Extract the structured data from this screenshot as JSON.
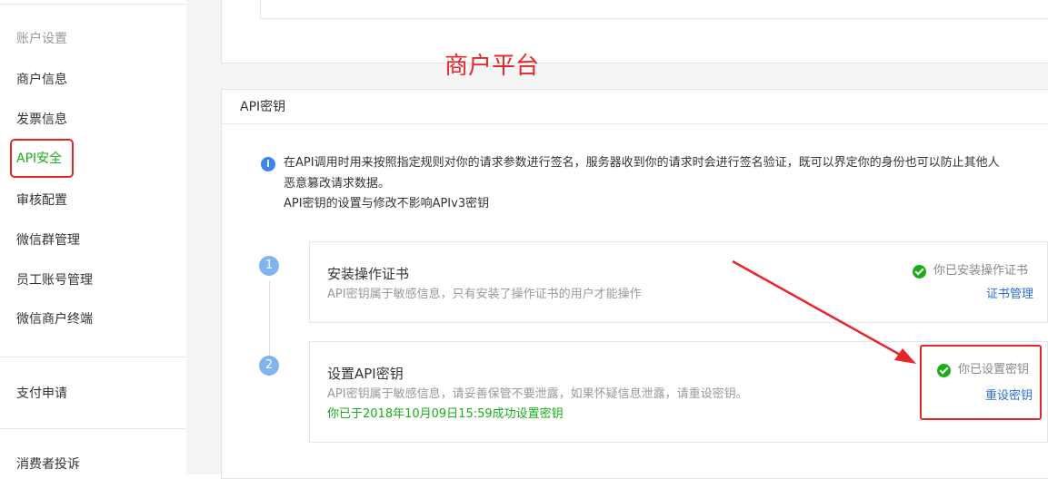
{
  "sidebar": {
    "section_title": "账户设置",
    "items": [
      {
        "label": "商户信息"
      },
      {
        "label": "发票信息"
      },
      {
        "label": "API安全",
        "active": true
      },
      {
        "label": "审核配置"
      },
      {
        "label": "微信群管理"
      },
      {
        "label": "员工账号管理"
      },
      {
        "label": "微信商户终端"
      },
      {
        "label": "支付申请"
      },
      {
        "label": "消费者投诉"
      }
    ]
  },
  "annotation": {
    "title": "商户平台",
    "color": "#e8262a"
  },
  "api_panel": {
    "header": "API密钥",
    "notice_lines": [
      "在API调用时用来按照指定规则对你的请求参数进行签名，服务器收到你的请求时会进行签名验证，既可以界定你的身份也可以防止其他人",
      "恶意篡改请求数据。",
      "API密钥的设置与修改不影响APIv3密钥"
    ],
    "steps": [
      {
        "number": "1",
        "title": "安装操作证书",
        "desc": "API密钥属于敏感信息，只有安装了操作证书的用户才能操作",
        "status": "你已安装操作证书",
        "action": "证书管理"
      },
      {
        "number": "2",
        "title": "设置API密钥",
        "desc": "API密钥属于敏感信息，请妥善保管不要泄露，如果怀疑信息泄露，请重设密钥。",
        "success_note": "你已于2018年10月09日15:59成功设置密钥",
        "status": "你已设置密钥",
        "action": "重设密钥"
      }
    ]
  },
  "colors": {
    "accent_red": "#e8262a",
    "active_green": "#1aad19",
    "link_blue": "#2a6fd6",
    "badge_blue": "#7fb4ee"
  },
  "icons": [
    "info-icon",
    "check-circle-icon"
  ]
}
